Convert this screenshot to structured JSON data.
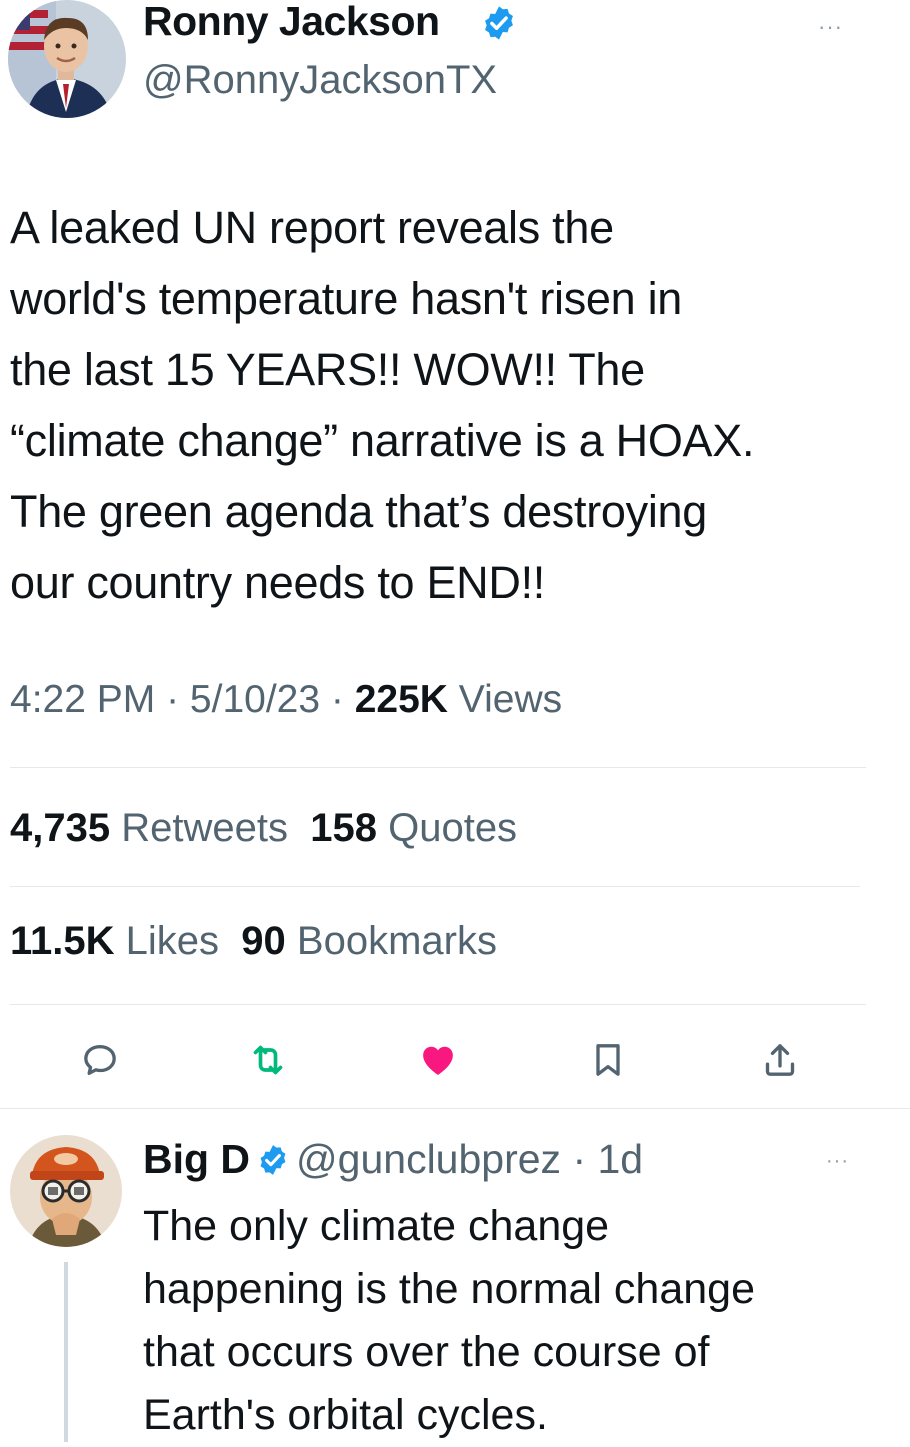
{
  "tweet": {
    "author_name": "Ronny Jackson",
    "author_handle": "@RonnyJacksonTX",
    "verified": true,
    "more_label": "···",
    "text": "A leaked UN report reveals the\nworld's temperature hasn't risen in\nthe last 15 YEARS!! WOW!! The\n“climate change” narrative is a HOAX.\nThe green agenda that’s destroying\nour country needs to END!!",
    "time": "4:22 PM",
    "separator": " · ",
    "date": "5/10/23",
    "views_count": "225K",
    "views_label": "Views",
    "stats": {
      "retweets_count": "4,735",
      "retweets_label": "Retweets",
      "quotes_count": "158",
      "quotes_label": "Quotes",
      "likes_count": "11.5K",
      "likes_label": "Likes",
      "bookmarks_count": "90",
      "bookmarks_label": "Bookmarks"
    }
  },
  "actions": {
    "reply_icon": "reply-icon",
    "retweet_icon": "retweet-icon",
    "like_icon": "heart-icon",
    "bookmark_icon": "bookmark-icon",
    "share_icon": "share-icon",
    "retweet_color": "#00ba7c",
    "like_color": "#f91880",
    "neutral_color": "#536471"
  },
  "reply": {
    "author_name": "Big D",
    "author_handle": "@gunclubprez",
    "separator": " · ",
    "age": "1d",
    "verified": true,
    "more_label": "···",
    "text": "The only climate change\nhappening is the normal change\nthat occurs over the course of\nEarth's orbital cycles."
  },
  "colors": {
    "verified_blue": "#1d9bf0",
    "text_primary": "#0f1419",
    "text_secondary": "#536471",
    "divider": "#e6e9ec"
  }
}
